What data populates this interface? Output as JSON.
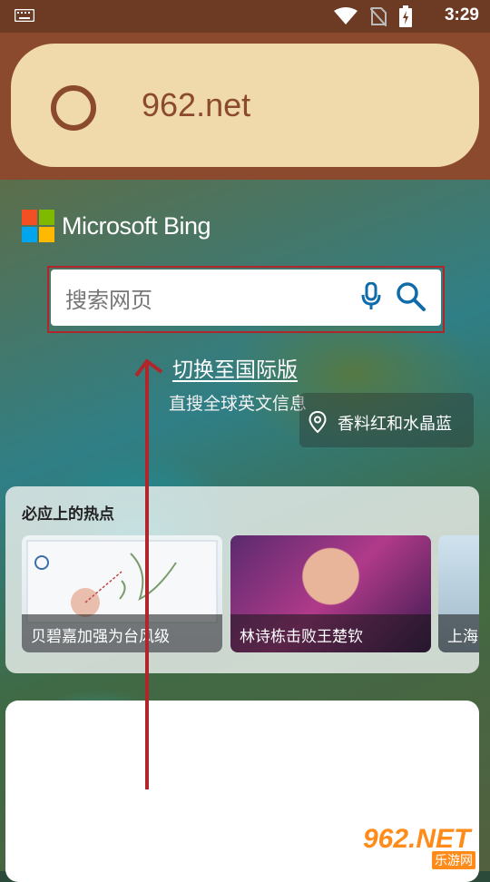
{
  "status_bar": {
    "time": "3:29"
  },
  "address_bar": {
    "url": "962.net"
  },
  "bing": {
    "logo_text": "Microsoft Bing"
  },
  "search": {
    "placeholder": "搜索网页"
  },
  "international": {
    "link_label": "切换至国际版",
    "subtitle": "直搜全球英文信息"
  },
  "location": {
    "label": "香料红和水晶蓝"
  },
  "hot_topics": {
    "title": "必应上的热点",
    "items": [
      {
        "caption": "贝碧嘉加强为台风级"
      },
      {
        "caption": "林诗栋击败王楚钦"
      },
      {
        "caption": "上海"
      }
    ]
  },
  "watermark": {
    "brand": "962.NET",
    "sub": "乐游网"
  },
  "colors": {
    "status_bar": "#6d3a24",
    "address_bar_bg": "#8b4a2d",
    "address_pill": "#f0d9ab",
    "highlight_red": "#b0262a"
  }
}
